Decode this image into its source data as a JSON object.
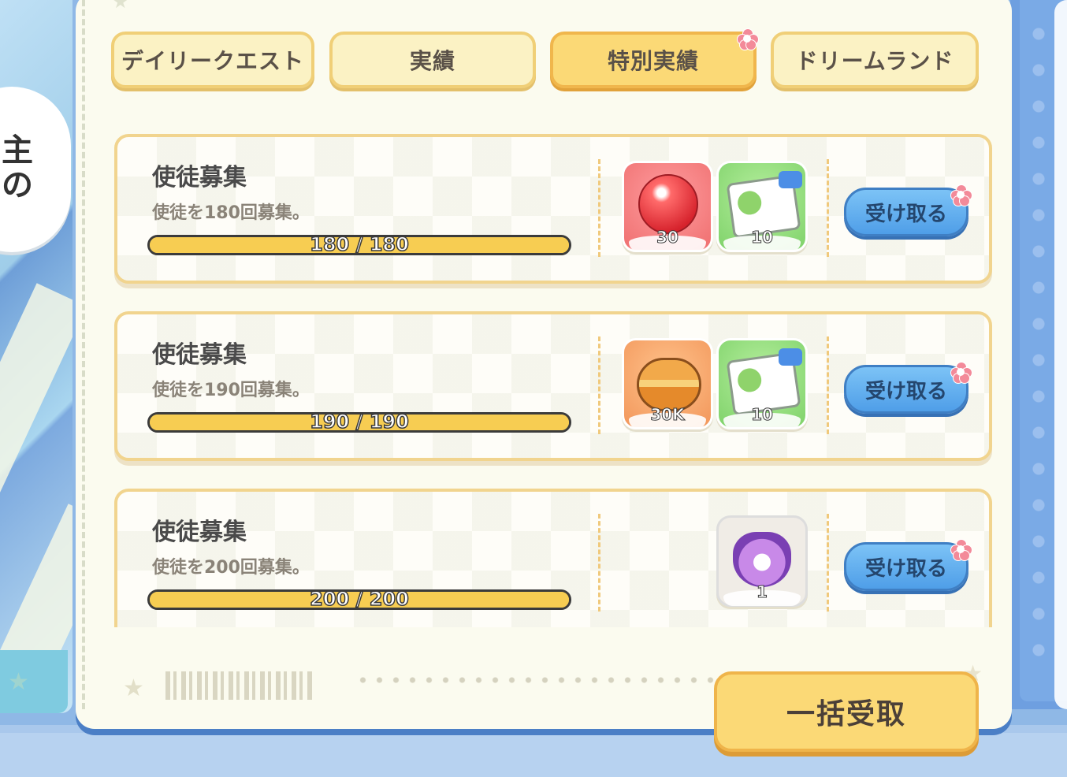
{
  "tabs": [
    {
      "label": "デイリークエスト",
      "active": false
    },
    {
      "label": "実績",
      "active": false
    },
    {
      "label": "特別実績",
      "active": true
    },
    {
      "label": "ドリームランド",
      "active": false
    }
  ],
  "left_bubble": {
    "line1": "主",
    "line2": "の"
  },
  "quests": [
    {
      "title": "使徒募集",
      "description": "使徒を180回募集。",
      "progress_text": "180 / 180",
      "progress": 1.0,
      "rewards": [
        {
          "icon": "red-orb-icon",
          "qty": "30"
        },
        {
          "icon": "green-ticket-icon",
          "qty": "10"
        }
      ],
      "claim_label": "受け取る"
    },
    {
      "title": "使徒募集",
      "description": "使徒を190回募集。",
      "progress_text": "190 / 190",
      "progress": 1.0,
      "rewards": [
        {
          "icon": "macaron-icon",
          "qty": "30K"
        },
        {
          "icon": "green-ticket-icon",
          "qty": "10"
        }
      ],
      "claim_label": "受け取る"
    },
    {
      "title": "使徒募集",
      "description": "使徒を200回募集。",
      "progress_text": "200 / 200",
      "progress": 1.0,
      "rewards": [
        {
          "icon": "character-heart-icon",
          "qty": "1"
        }
      ],
      "claim_label": "受け取る"
    }
  ],
  "collect_all_label": "一括受取",
  "colors": {
    "tab_active": "#fbd976",
    "tab_inactive": "#fbf2c4",
    "claim": "#5fa9ee",
    "progress": "#f7cd52",
    "notify": "#f38a99"
  }
}
